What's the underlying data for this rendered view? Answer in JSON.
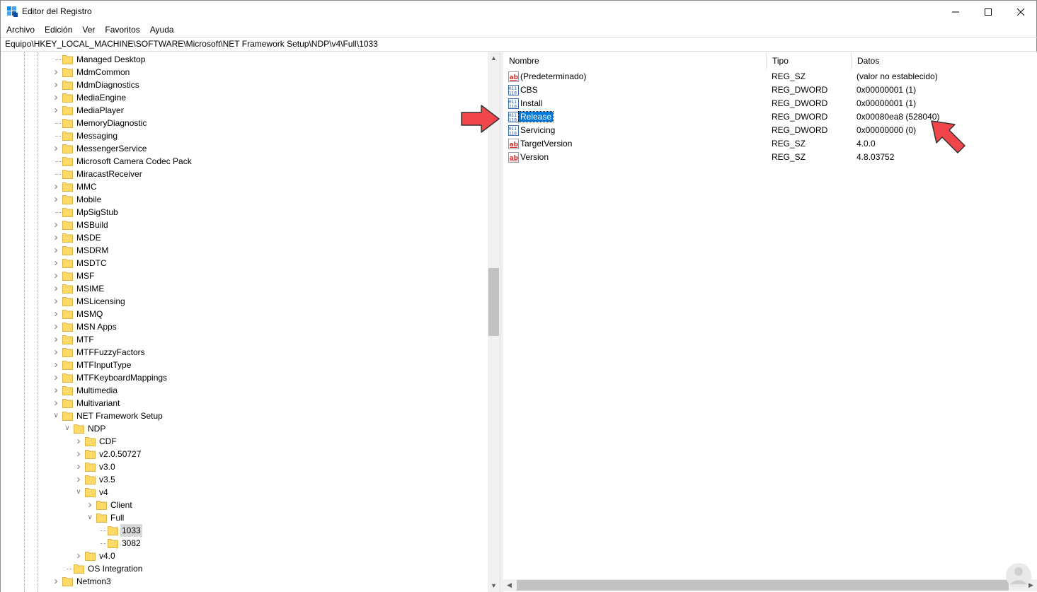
{
  "window": {
    "title": "Editor del Registro"
  },
  "menu": [
    "Archivo",
    "Edición",
    "Ver",
    "Favoritos",
    "Ayuda"
  ],
  "address": "Equipo\\HKEY_LOCAL_MACHINE\\SOFTWARE\\Microsoft\\NET Framework Setup\\NDP\\v4\\Full\\1033",
  "tree": [
    {
      "label": "Managed Desktop",
      "level": 0,
      "chevron": "none"
    },
    {
      "label": "MdmCommon",
      "level": 0,
      "chevron": "right"
    },
    {
      "label": "MdmDiagnostics",
      "level": 0,
      "chevron": "right"
    },
    {
      "label": "MediaEngine",
      "level": 0,
      "chevron": "right"
    },
    {
      "label": "MediaPlayer",
      "level": 0,
      "chevron": "right"
    },
    {
      "label": "MemoryDiagnostic",
      "level": 0,
      "chevron": "none"
    },
    {
      "label": "Messaging",
      "level": 0,
      "chevron": "none"
    },
    {
      "label": "MessengerService",
      "level": 0,
      "chevron": "right"
    },
    {
      "label": "Microsoft Camera Codec Pack",
      "level": 0,
      "chevron": "none"
    },
    {
      "label": "MiracastReceiver",
      "level": 0,
      "chevron": "none"
    },
    {
      "label": "MMC",
      "level": 0,
      "chevron": "right"
    },
    {
      "label": "Mobile",
      "level": 0,
      "chevron": "right"
    },
    {
      "label": "MpSigStub",
      "level": 0,
      "chevron": "none"
    },
    {
      "label": "MSBuild",
      "level": 0,
      "chevron": "right"
    },
    {
      "label": "MSDE",
      "level": 0,
      "chevron": "right"
    },
    {
      "label": "MSDRM",
      "level": 0,
      "chevron": "right"
    },
    {
      "label": "MSDTC",
      "level": 0,
      "chevron": "right"
    },
    {
      "label": "MSF",
      "level": 0,
      "chevron": "right"
    },
    {
      "label": "MSIME",
      "level": 0,
      "chevron": "right"
    },
    {
      "label": "MSLicensing",
      "level": 0,
      "chevron": "right"
    },
    {
      "label": "MSMQ",
      "level": 0,
      "chevron": "right"
    },
    {
      "label": "MSN Apps",
      "level": 0,
      "chevron": "right"
    },
    {
      "label": "MTF",
      "level": 0,
      "chevron": "right"
    },
    {
      "label": "MTFFuzzyFactors",
      "level": 0,
      "chevron": "right"
    },
    {
      "label": "MTFInputType",
      "level": 0,
      "chevron": "right"
    },
    {
      "label": "MTFKeyboardMappings",
      "level": 0,
      "chevron": "right"
    },
    {
      "label": "Multimedia",
      "level": 0,
      "chevron": "right"
    },
    {
      "label": "Multivariant",
      "level": 0,
      "chevron": "right"
    },
    {
      "label": "NET Framework Setup",
      "level": 0,
      "chevron": "down"
    },
    {
      "label": "NDP",
      "level": 1,
      "chevron": "down"
    },
    {
      "label": "CDF",
      "level": 2,
      "chevron": "right"
    },
    {
      "label": "v2.0.50727",
      "level": 2,
      "chevron": "right"
    },
    {
      "label": "v3.0",
      "level": 2,
      "chevron": "right"
    },
    {
      "label": "v3.5",
      "level": 2,
      "chevron": "right"
    },
    {
      "label": "v4",
      "level": 2,
      "chevron": "down"
    },
    {
      "label": "Client",
      "level": 3,
      "chevron": "right"
    },
    {
      "label": "Full",
      "level": 3,
      "chevron": "down"
    },
    {
      "label": "1033",
      "level": 4,
      "chevron": "none",
      "selected": true
    },
    {
      "label": "3082",
      "level": 4,
      "chevron": "none"
    },
    {
      "label": "v4.0",
      "level": 2,
      "chevron": "right"
    },
    {
      "label": "OS Integration",
      "level": 1,
      "chevron": "none"
    },
    {
      "label": "Netmon3",
      "level": 0,
      "chevron": "right"
    }
  ],
  "columns": {
    "name": "Nombre",
    "type": "Tipo",
    "data": "Datos"
  },
  "values": [
    {
      "name": "(Predeterminado)",
      "type": "REG_SZ",
      "data": "(valor no establecido)",
      "icon": "string-value-icon"
    },
    {
      "name": "CBS",
      "type": "REG_DWORD",
      "data": "0x00000001 (1)",
      "icon": "binary-value-icon"
    },
    {
      "name": "Install",
      "type": "REG_DWORD",
      "data": "0x00000001 (1)",
      "icon": "binary-value-icon"
    },
    {
      "name": "Release",
      "type": "REG_DWORD",
      "data": "0x00080ea8 (528040)",
      "icon": "binary-value-icon",
      "selected": true
    },
    {
      "name": "Servicing",
      "type": "REG_DWORD",
      "data": "0x00000000 (0)",
      "icon": "binary-value-icon"
    },
    {
      "name": "TargetVersion",
      "type": "REG_SZ",
      "data": "4.0.0",
      "icon": "string-value-icon"
    },
    {
      "name": "Version",
      "type": "REG_SZ",
      "data": "4.8.03752",
      "icon": "string-value-icon"
    }
  ],
  "colors": {
    "selection": "#0078d7",
    "folder": "#ffd966",
    "annotation_arrow": "#f0454a"
  }
}
